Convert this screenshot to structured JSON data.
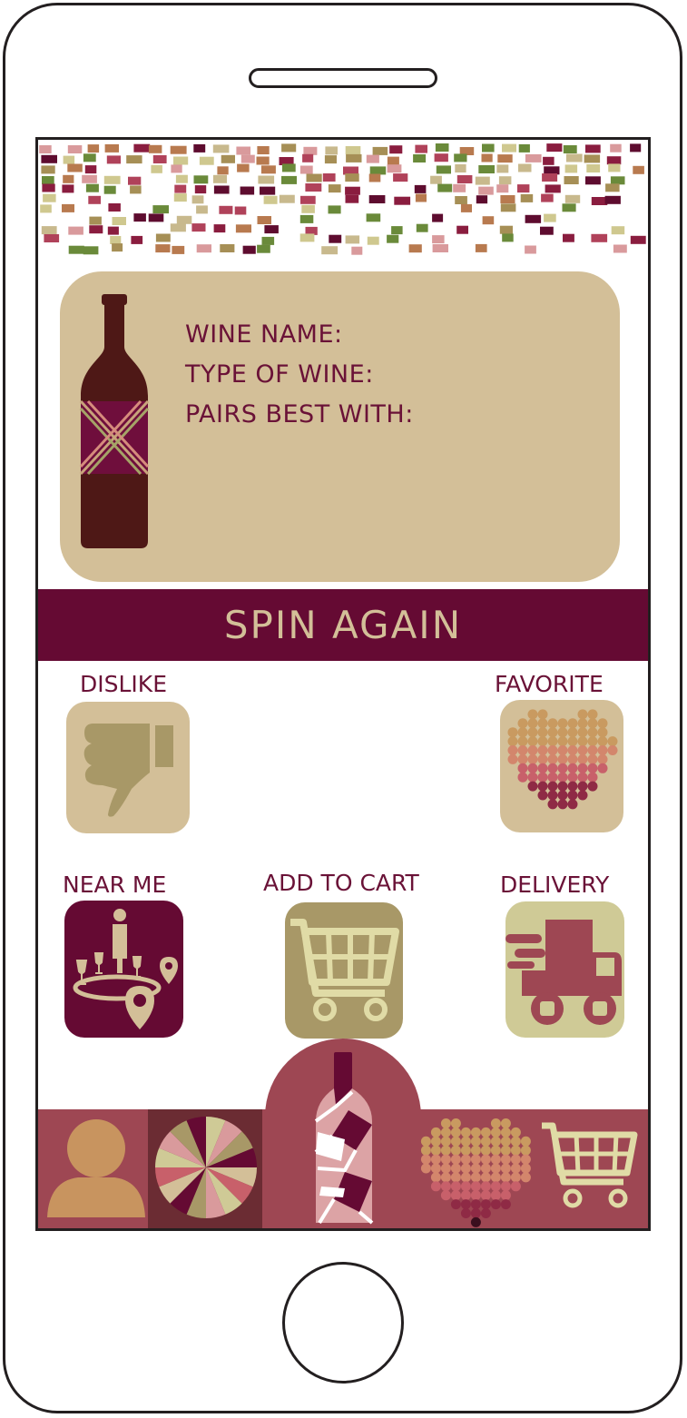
{
  "wine_card": {
    "name_label": "WINE NAME:",
    "type_label": "TYPE OF WINE:",
    "pairs_label": "PAIRS BEST WITH:"
  },
  "spin_button": {
    "label": "SPIN AGAIN"
  },
  "actions": {
    "dislike": {
      "label": "DISLIKE",
      "icon": "thumbs-down-icon"
    },
    "favorite": {
      "label": "FAVORITE",
      "icon": "heart-icon"
    },
    "near_me": {
      "label": "NEAR ME",
      "icon": "location-pin-icon"
    },
    "add_to_cart": {
      "label": "ADD TO CART",
      "icon": "shopping-cart-icon"
    },
    "delivery": {
      "label": "DELIVERY",
      "icon": "delivery-truck-icon"
    }
  },
  "bottom_nav": {
    "items": [
      {
        "icon": "profile-icon"
      },
      {
        "icon": "spin-wheel-icon",
        "active": true
      },
      {
        "icon": "wine-map-icon"
      },
      {
        "icon": "favorites-heart-icon"
      },
      {
        "icon": "cart-icon"
      }
    ]
  },
  "colors": {
    "burgundy": "#650a33",
    "tan": "#d3bf98",
    "olive_tan": "#a89867",
    "rose": "#9e4753",
    "sage": "#cfca96",
    "cart_cream": "#e0dba6",
    "profile_orange": "#c8945f"
  }
}
